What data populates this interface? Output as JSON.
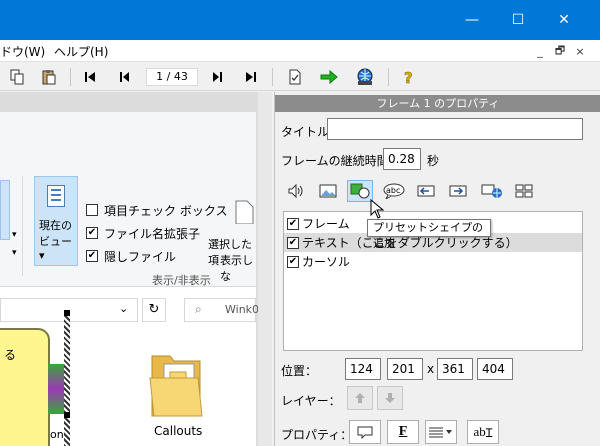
{
  "window": {
    "minimize_glyph": "—",
    "maximize_glyph": "☐",
    "close_glyph": "✕"
  },
  "menu": {
    "window": "ドウ(W)",
    "help": "ヘルプ(H)",
    "mdi_minimize": "_",
    "mdi_restore": "🗗",
    "mdi_close": "×"
  },
  "toolbar": {
    "page_counter": "1 / 43",
    "icons": [
      "copy-icon",
      "paste-icon",
      "first-frame-icon",
      "prev-frame-icon",
      "next-frame-icon",
      "last-frame-icon",
      "document-check-icon",
      "go-arrow-icon",
      "globe-icon",
      "help-icon"
    ]
  },
  "explorer": {
    "ribbon": {
      "checkbox_item_check": "項目チェック ボックス",
      "checkbox_file_ext": "ファイル名拡張子",
      "checkbox_hidden": "隠しファイル",
      "current_view_line1": "現在の",
      "current_view_line2": "ビュー",
      "selected_line1": "選択した項",
      "selected_line2": "表示しな",
      "group_label": "表示/非表示",
      "item_check_checked": false,
      "file_ext_checked": true,
      "hidden_checked": true
    },
    "search_placeholder": "Wink0",
    "folder_label": "Callouts",
    "callout_text": "る",
    "partial_label": "on"
  },
  "properties": {
    "header": "フレーム 1 のプロパティ",
    "title_label": "タイトル",
    "title_value": "",
    "duration_label": "フレームの継続時間",
    "duration_value": "0.28",
    "duration_unit": "秒",
    "layers": [
      {
        "label": "フレーム",
        "checked": true
      },
      {
        "label": "テキスト（ここをダブルクリックする）",
        "checked": true
      },
      {
        "label": "カーソル",
        "checked": true
      }
    ],
    "tooltip": "プリセットシェイプの追加",
    "position_label": "位置：",
    "pos_x": "124",
    "pos_y": "201",
    "pos_sep": "x",
    "pos_w": "361",
    "pos_h": "404",
    "layer_label": "レイヤー：",
    "property_label": "プロパティ：",
    "prop_font_glyph": "F",
    "prop_text_glyph": "ab",
    "check_glyph": "✔"
  },
  "colors": {
    "titlebar": "#0078d7",
    "callout_fill": "#fff68f",
    "folder_fill": "#f7d774",
    "header_gray": "#8c8c8c"
  }
}
